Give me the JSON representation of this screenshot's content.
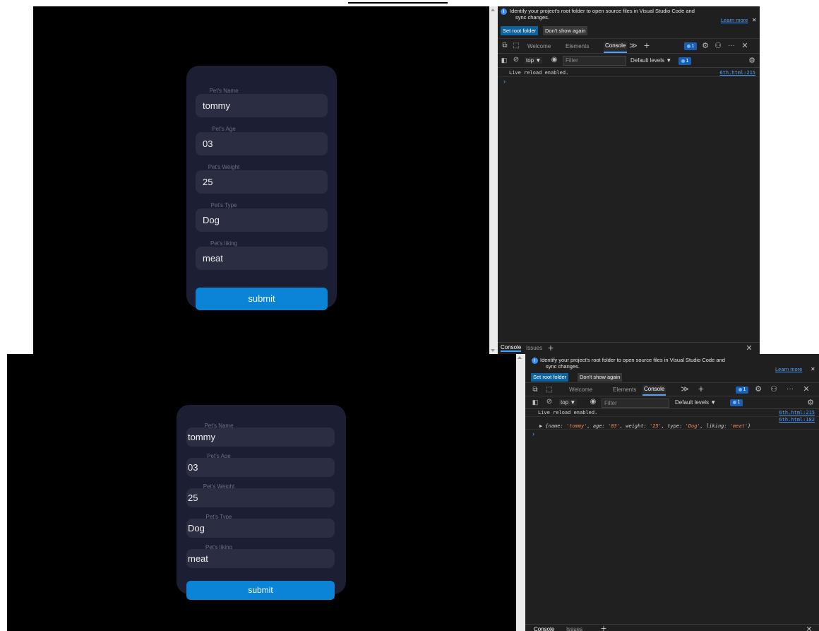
{
  "form": {
    "fields": [
      {
        "label": "Pet's Name",
        "value": "tommy"
      },
      {
        "label": "Pet's Age",
        "value": "03"
      },
      {
        "label": "Pet's Weight",
        "value": "25"
      },
      {
        "label": "Pet's Type",
        "value": "Dog"
      },
      {
        "label": "Pet's liking",
        "value": "meat"
      }
    ],
    "submit_label": "submit"
  },
  "devtools": {
    "banner": {
      "text_line1": "Identify your project's root folder to open source files in Visual Studio Code and",
      "text_line2": "sync changes.",
      "learn_more": "Learn more",
      "close": "✕",
      "set_root": "Set root folder",
      "dont_show": "Don't show again"
    },
    "tabs": {
      "welcome": "Welcome",
      "elements": "Elements",
      "console": "Console",
      "more": "≫",
      "add": "+",
      "issues_count": "1",
      "more_menu": "···",
      "close": "✕"
    },
    "toolbar": {
      "context": "top ▼",
      "filter_placeholder": "Filter",
      "levels": "Default levels ▼",
      "issues_count": "1"
    },
    "console_log": {
      "line1": "Live reload enabled.",
      "line1_source": "6th.html:215",
      "line2_source": "6th.html:182",
      "object_prefix": "▶ {",
      "obj_name_key": "name: ",
      "obj_name_val": "'tommy'",
      "obj_age_key": ", age: ",
      "obj_age_val": "'03'",
      "obj_weight_key": ", weight: ",
      "obj_weight_val": "'25'",
      "obj_type_key": ", type: ",
      "obj_type_val": "'Dog'",
      "obj_liking_key": ", liking: ",
      "obj_liking_val": "'meat'",
      "object_suffix": "}",
      "prompt": "›"
    },
    "bottom": {
      "console": "Console",
      "issues": "Issues",
      "add": "+",
      "close": "✕"
    }
  },
  "colors": {
    "card_bg": "#1c1f33",
    "field_bg": "#2b2d42",
    "submit_bg": "#0a84d6",
    "devtools_bg": "#202020",
    "link": "#4ea1ff"
  }
}
